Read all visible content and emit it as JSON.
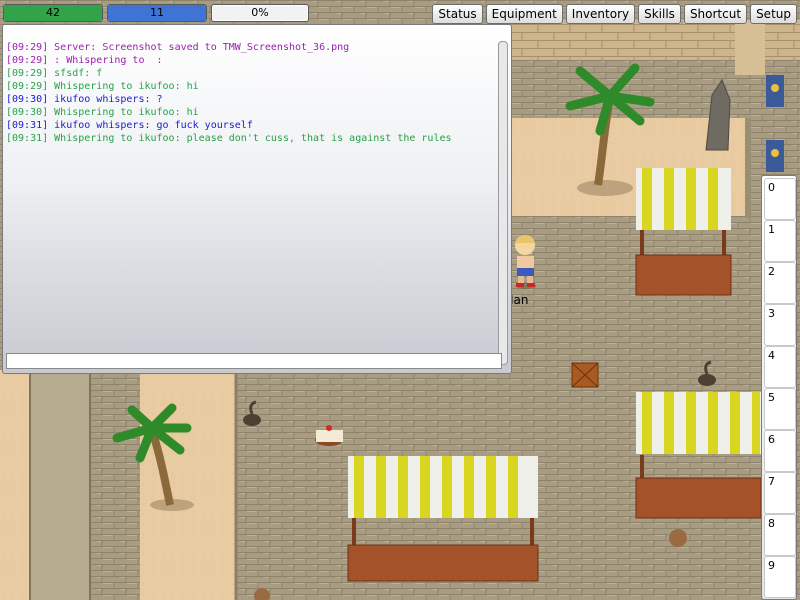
{
  "status_bars": {
    "hp": {
      "value": "42",
      "fill_fraction": 1.0,
      "color": "#31a34a"
    },
    "mp": {
      "value": "11",
      "fill_fraction": 1.0,
      "color": "#3f73d4"
    },
    "xp": {
      "value": "0%",
      "fill_fraction": 0.0,
      "color": "#e8e8e8"
    }
  },
  "menu_buttons": [
    "Status",
    "Equipment",
    "Inventory",
    "Skills",
    "Shortcut",
    "Setup"
  ],
  "chat": {
    "lines": [
      {
        "text": "[09:29] Server: Screenshot saved to TMW_Screenshot_36.png",
        "color": "purple"
      },
      {
        "text": "[09:29] : Whispering to  :",
        "color": "purple"
      },
      {
        "text": "[09:29] sfsdf: f",
        "color": "green"
      },
      {
        "text": "[09:29] Whispering to ikufoo: hi",
        "color": "green"
      },
      {
        "text": "[09:30] ikufoo whispers: ?",
        "color": "blue"
      },
      {
        "text": "[09:30] Whispering to ikufoo: hi",
        "color": "green"
      },
      {
        "text": "[09:31] ikufoo whispers: go fuck yourself",
        "color": "blue"
      },
      {
        "text": "[09:31] Whispering to ikufoo: please don't cuss, that is against the rules",
        "color": "green"
      }
    ],
    "input_value": ""
  },
  "shortcut_slots": [
    "0",
    "1",
    "2",
    "3",
    "4",
    "5",
    "6",
    "7",
    "8",
    "9"
  ],
  "player": {
    "name": "Ian"
  },
  "colors": {
    "ground_cobble": "#a89c82",
    "sand": "#e8cba0",
    "awning_yellow": "#d8d620",
    "awning_white": "#f0f0ea",
    "stall_wood": "#a4522a"
  },
  "scene_objects": [
    "palm-tree",
    "palm-tree",
    "stone-statue",
    "market-stall",
    "market-stall",
    "market-stall",
    "wooden-crate",
    "cake",
    "scorpion",
    "scorpion",
    "scorpion",
    "clay-pot",
    "banner"
  ]
}
